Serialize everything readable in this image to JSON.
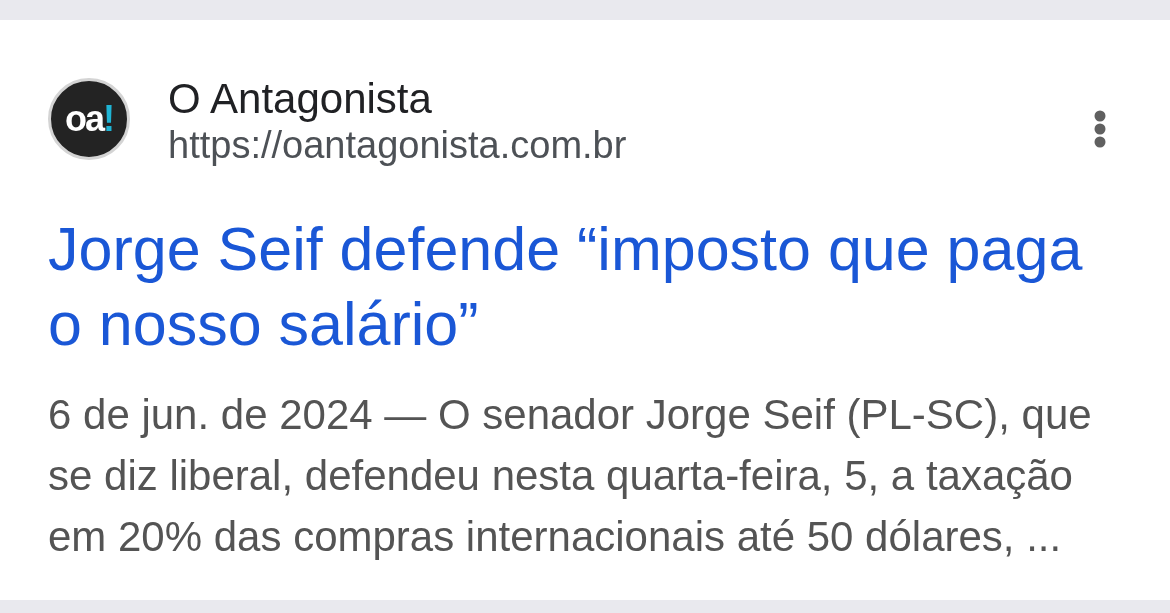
{
  "result": {
    "site": {
      "logo": {
        "letters": "oa",
        "accent": "!"
      },
      "name": "O Antagonista",
      "url": "https://oantagonista.com.br"
    },
    "title_lines": [
      "Jorge Seif defende “imposto que paga",
      "o nosso salário”"
    ],
    "snippet_lines": [
      "6 de jun. de 2024 — O senador Jorge Seif (PL-SC), que",
      "se diz liberal, defendeu nesta quarta-feira, 5, a taxação",
      "em 20% das compras internacionais até 50 dólares, ..."
    ]
  }
}
